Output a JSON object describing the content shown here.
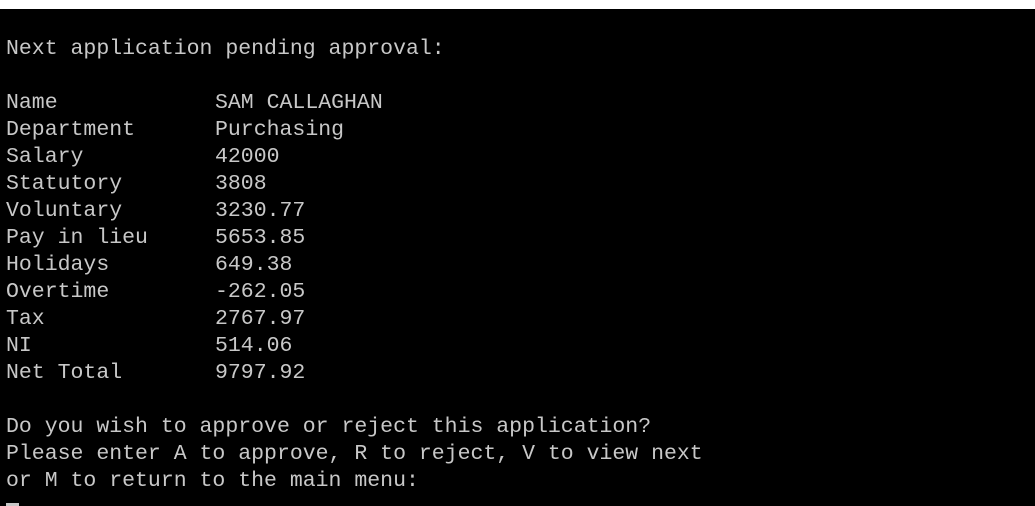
{
  "terminal": {
    "heading": "Next application pending approval:",
    "fields": [
      {
        "label": "Name",
        "value": "SAM CALLAGHAN"
      },
      {
        "label": "Department",
        "value": "Purchasing"
      },
      {
        "label": "Salary",
        "value": "42000"
      },
      {
        "label": "Statutory",
        "value": "3808"
      },
      {
        "label": "Voluntary",
        "value": "3230.77"
      },
      {
        "label": "Pay in lieu",
        "value": "5653.85"
      },
      {
        "label": "Holidays",
        "value": "649.38"
      },
      {
        "label": "Overtime",
        "value": "-262.05"
      },
      {
        "label": "Tax",
        "value": "2767.97"
      },
      {
        "label": "NI",
        "value": "514.06"
      },
      {
        "label": "Net Total",
        "value": "9797.92"
      }
    ],
    "prompt_lines": [
      "Do you wish to approve or reject this application?",
      "Please enter A to approve, R to reject, V to view next",
      "or M to return to the main menu:"
    ],
    "colors": {
      "background": "#000000",
      "text": "#c8c8c8"
    }
  }
}
